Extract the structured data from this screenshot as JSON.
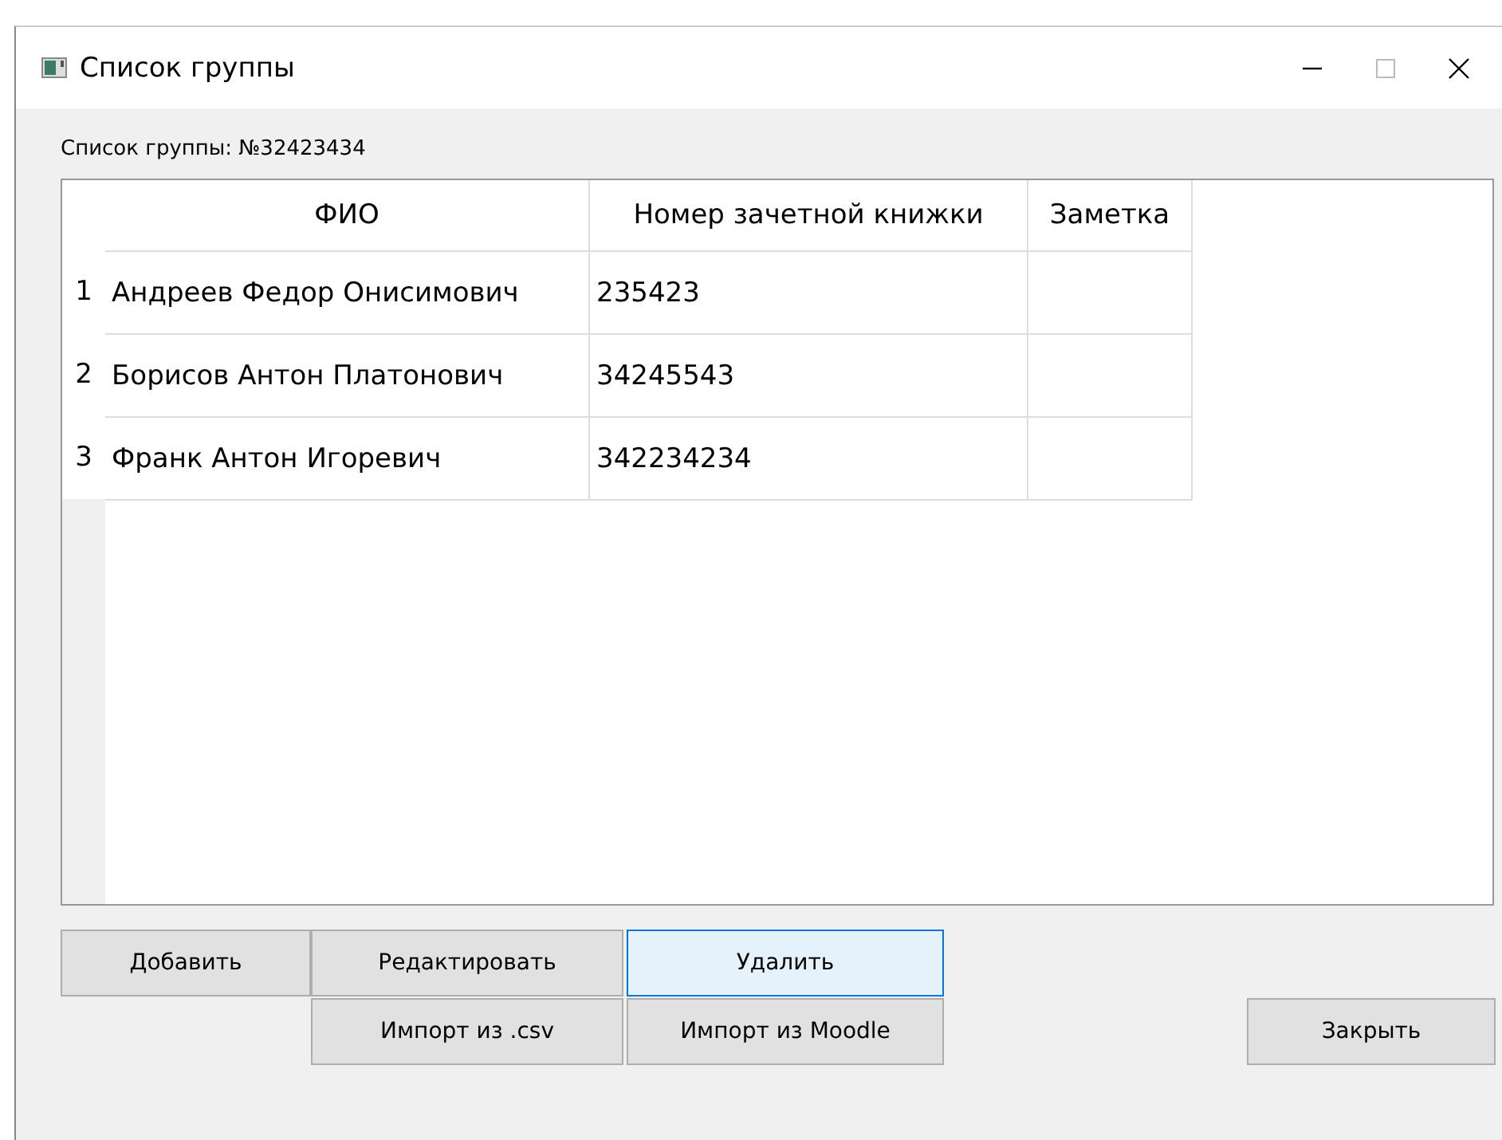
{
  "window": {
    "title": "Список группы"
  },
  "group_label": "Список группы: №32423434",
  "table": {
    "columns": [
      "ФИО",
      "Номер зачетной книжки",
      "Заметка"
    ],
    "rows": [
      {
        "number": "1",
        "cells": [
          "Андреев Федор Онисимович",
          "235423",
          ""
        ]
      },
      {
        "number": "2",
        "cells": [
          "Борисов Антон Платонович",
          "34245543",
          ""
        ]
      },
      {
        "number": "3",
        "cells": [
          "Франк Антон Игоревич",
          "342234234",
          ""
        ]
      }
    ]
  },
  "button_rows": [
    [
      {
        "label": "Добавить",
        "focused": false
      },
      {
        "label": "Редактировать",
        "focused": false
      },
      {
        "label": "Удалить",
        "focused": true
      }
    ],
    [
      {
        "label": "Импорт из .csv",
        "focused": false
      },
      {
        "label": "Импорт из Moodle",
        "focused": false
      }
    ]
  ],
  "close_button": {
    "label": "Закрыть",
    "focused": false
  }
}
